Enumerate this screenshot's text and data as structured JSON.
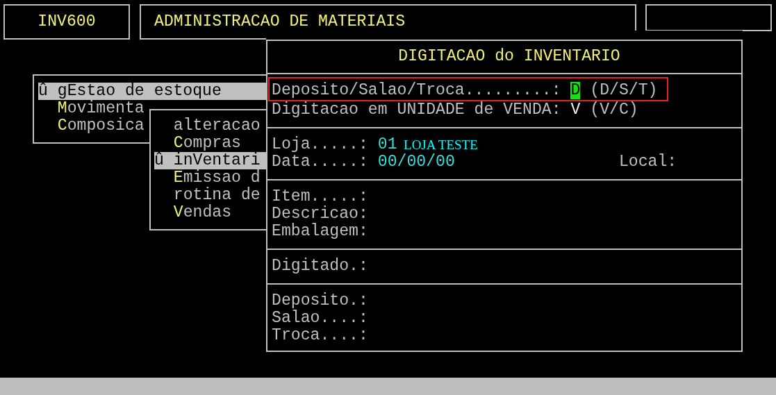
{
  "header": {
    "program": "INV600",
    "title": "ADMINISTRACAO DE MATERIAIS"
  },
  "menus": [
    {
      "items": [
        {
          "selected": true,
          "marker": "û",
          "text": "gEstao de estoque"
        },
        {
          "selected": false,
          "hotkey": "M",
          "text": "ovimenta"
        },
        {
          "selected": false,
          "hotkey": "C",
          "text": "omposica"
        }
      ]
    },
    {
      "items": [
        {
          "selected": false,
          "text": "alteracao"
        },
        {
          "selected": false,
          "hotkey": "C",
          "text": "ompras"
        },
        {
          "selected": true,
          "marker": "û",
          "text": "inVentari"
        },
        {
          "selected": false,
          "hotkey": "E",
          "text": "missao d"
        },
        {
          "selected": false,
          "text": "rotina de"
        },
        {
          "selected": false,
          "hotkey": "V",
          "text": "endas"
        }
      ]
    }
  ],
  "dialog": {
    "title": "DIGITACAO do INVENTARIO",
    "sections": [
      {
        "rows": [
          {
            "label": "Deposito/Salao/Troca.........:",
            "value": {
              "text": "D",
              "kind": "cursor"
            },
            "hint": "(D/S/T)",
            "outlined": true
          },
          {
            "label": "Digitacao em UNIDADE de VENDA:",
            "value": {
              "text": "V",
              "kind": "option"
            },
            "hint": "(V/C)",
            "outlined": false
          }
        ]
      },
      {
        "rows": [
          {
            "label": "Loja.....:",
            "value": {
              "text": "01",
              "kind": "data"
            },
            "name": "LOJA TESTE",
            "outlined": false
          },
          {
            "label": "Data.....:",
            "value": {
              "text": "00/00/00",
              "kind": "data"
            },
            "side_label": "Local:",
            "outlined": false
          }
        ]
      },
      {
        "rows": [
          {
            "label": "Item.....:",
            "outlined": false
          },
          {
            "label": "Descricao:",
            "outlined": false
          },
          {
            "label": "Embalagem:",
            "outlined": false
          }
        ]
      },
      {
        "rows": [
          {
            "label": "Digitado.:",
            "outlined": false
          }
        ]
      },
      {
        "rows": [
          {
            "label": "Deposito.:",
            "outlined": false
          },
          {
            "label": "Salao....:",
            "outlined": false
          },
          {
            "label": "Troca....:",
            "outlined": false
          }
        ]
      }
    ]
  }
}
